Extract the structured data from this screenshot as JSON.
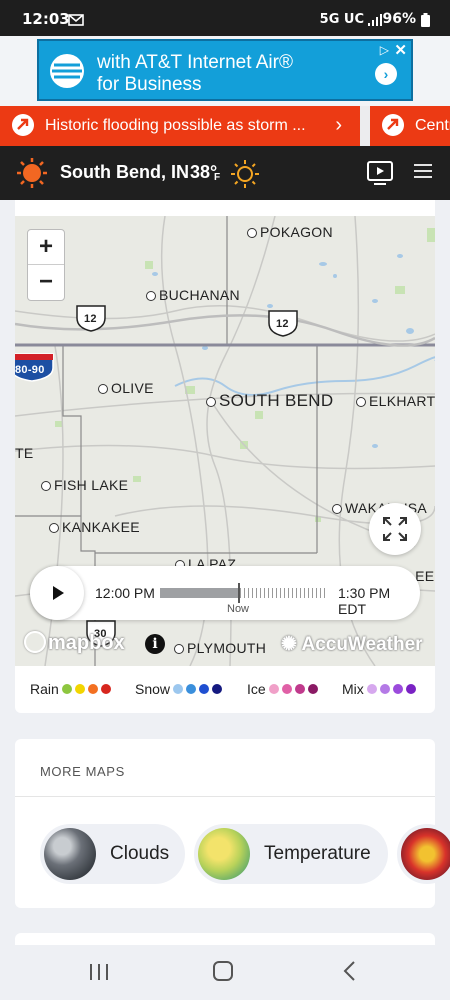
{
  "status_bar": {
    "time": "12:03",
    "network": "5G UC",
    "battery": "96%"
  },
  "ad": {
    "line1": "with AT&T Internet Air®",
    "line2": "for Business"
  },
  "alerts": [
    {
      "text": "Historic flooding possible as storm ..."
    },
    {
      "text": "Centr"
    }
  ],
  "header": {
    "location": "South Bend, IN",
    "temperature": "38°",
    "unit": "F"
  },
  "map": {
    "labels": {
      "pokagon": "POKAGON",
      "buchanan": "BUCHANAN",
      "olive": "OLIVE",
      "south_bend": "SOUTH BEND",
      "elkhart": "ELKHART",
      "te": "TE",
      "fish_lake": "FISH LAKE",
      "wakarusa": "WAKARUSA",
      "kankakee": "KANKAKEE",
      "la_paz": "LA PAZ",
      "lee": "LEE",
      "plymouth": "PLYMOUTH",
      "hwy_12a": "12",
      "hwy_12b": "12",
      "hwy_30": "30",
      "i_80_90": "80-90"
    },
    "zoom_in": "+",
    "zoom_out": "−",
    "timeline": {
      "start": "12:00 PM",
      "end": "1:30 PM EDT",
      "now_label": "Now",
      "progress": 0.48
    },
    "mapbox_logo": "mapbox",
    "info": "i",
    "accuweather_logo": "AccuWeather"
  },
  "legend": [
    {
      "label": "Rain",
      "colors": [
        "#8dc63f",
        "#f2d500",
        "#f37021",
        "#d7261e"
      ]
    },
    {
      "label": "Snow",
      "colors": [
        "#9cc7ee",
        "#3a8fdc",
        "#1f4fd1",
        "#151a80"
      ]
    },
    {
      "label": "Ice",
      "colors": [
        "#f0a0c8",
        "#e060a6",
        "#c03a8c",
        "#8a1a64"
      ]
    },
    {
      "label": "Mix",
      "colors": [
        "#d6a8ee",
        "#b47ae6",
        "#9b4bdc",
        "#7a22c4"
      ]
    }
  ],
  "more_maps": {
    "title": "MORE MAPS",
    "chips": [
      {
        "label": "Clouds"
      },
      {
        "label": "Temperature"
      }
    ]
  }
}
